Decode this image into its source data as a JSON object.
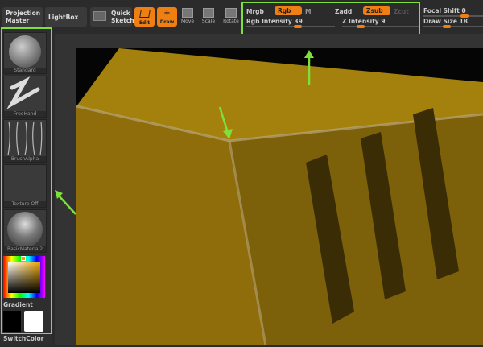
{
  "toolbar": {
    "projection_master": "Projection Master",
    "lightbox": "LightBox",
    "quick_sketch": "Quick Sketch",
    "edit": "Edit",
    "draw": "Draw",
    "move": "Move",
    "scale": "Scale",
    "rotate": "Rotate"
  },
  "draw_settings": {
    "mrgb": "Mrgb",
    "rgb": "Rgb",
    "m": "M",
    "zadd": "Zadd",
    "zsub": "Zsub",
    "zcut": "Zcut",
    "rgb_intensity_label": "Rgb Intensity",
    "rgb_intensity": "39",
    "z_intensity_label": "Z Intensity",
    "z_intensity": "9",
    "focal_shift_label": "Focal Shift",
    "focal_shift": "0",
    "draw_size_label": "Draw Size",
    "draw_size": "18"
  },
  "left_shelf": {
    "brush": "Standard",
    "stroke": "FreeHand",
    "alpha": "BrushAlpha",
    "texture": "Texture Off",
    "material": "BasicMaterial2",
    "gradient": "Gradient",
    "switch_color": "SwitchColor"
  },
  "colors": {
    "accent": "#f07f13",
    "highlight": "#7ee03a",
    "model": "#a07d0c"
  }
}
